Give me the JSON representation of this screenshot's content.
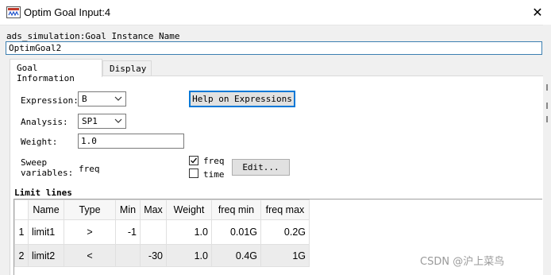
{
  "window": {
    "title": "Optim Goal Input:4",
    "close_symbol": "✕"
  },
  "instance": {
    "label": "ads_simulation:Goal Instance Name",
    "value": "OptimGoal2"
  },
  "tabs": [
    {
      "label": "Goal Information",
      "active": true
    },
    {
      "label": "Display",
      "active": false
    }
  ],
  "form": {
    "expression_label": "Expression:",
    "expression_value": "B",
    "help_button": "Help on Expressions",
    "analysis_label": "Analysis:",
    "analysis_value": "SP1",
    "weight_label": "Weight:",
    "weight_value": "1.0",
    "sweep_label_line1": "Sweep",
    "sweep_label_line2": "variables:",
    "sweep_value": "freq",
    "freq_checkbox": {
      "label": "freq",
      "checked": true
    },
    "time_checkbox": {
      "label": "time",
      "checked": false
    },
    "edit_button": "Edit..."
  },
  "limit_lines": {
    "title": "Limit lines",
    "columns": [
      "Name",
      "Type",
      "Min",
      "Max",
      "Weight",
      "freq min",
      "freq max"
    ],
    "rows": [
      {
        "num": "1",
        "name": "limit1",
        "type": ">",
        "min": "-1",
        "max": "",
        "weight": "1.0",
        "freq_min": "0.01G",
        "freq_max": "0.2G"
      },
      {
        "num": "2",
        "name": "limit2",
        "type": "<",
        "min": "",
        "max": "-30",
        "weight": "1.0",
        "freq_min": "0.4G",
        "freq_max": "1G"
      }
    ]
  },
  "watermark": "CSDN @沪上菜鸟",
  "colors": {
    "focus_border": "#0078d7",
    "input_border": "#3c7fb1",
    "panel_bg": "#ffffff",
    "window_bg": "#f0f0f0"
  }
}
